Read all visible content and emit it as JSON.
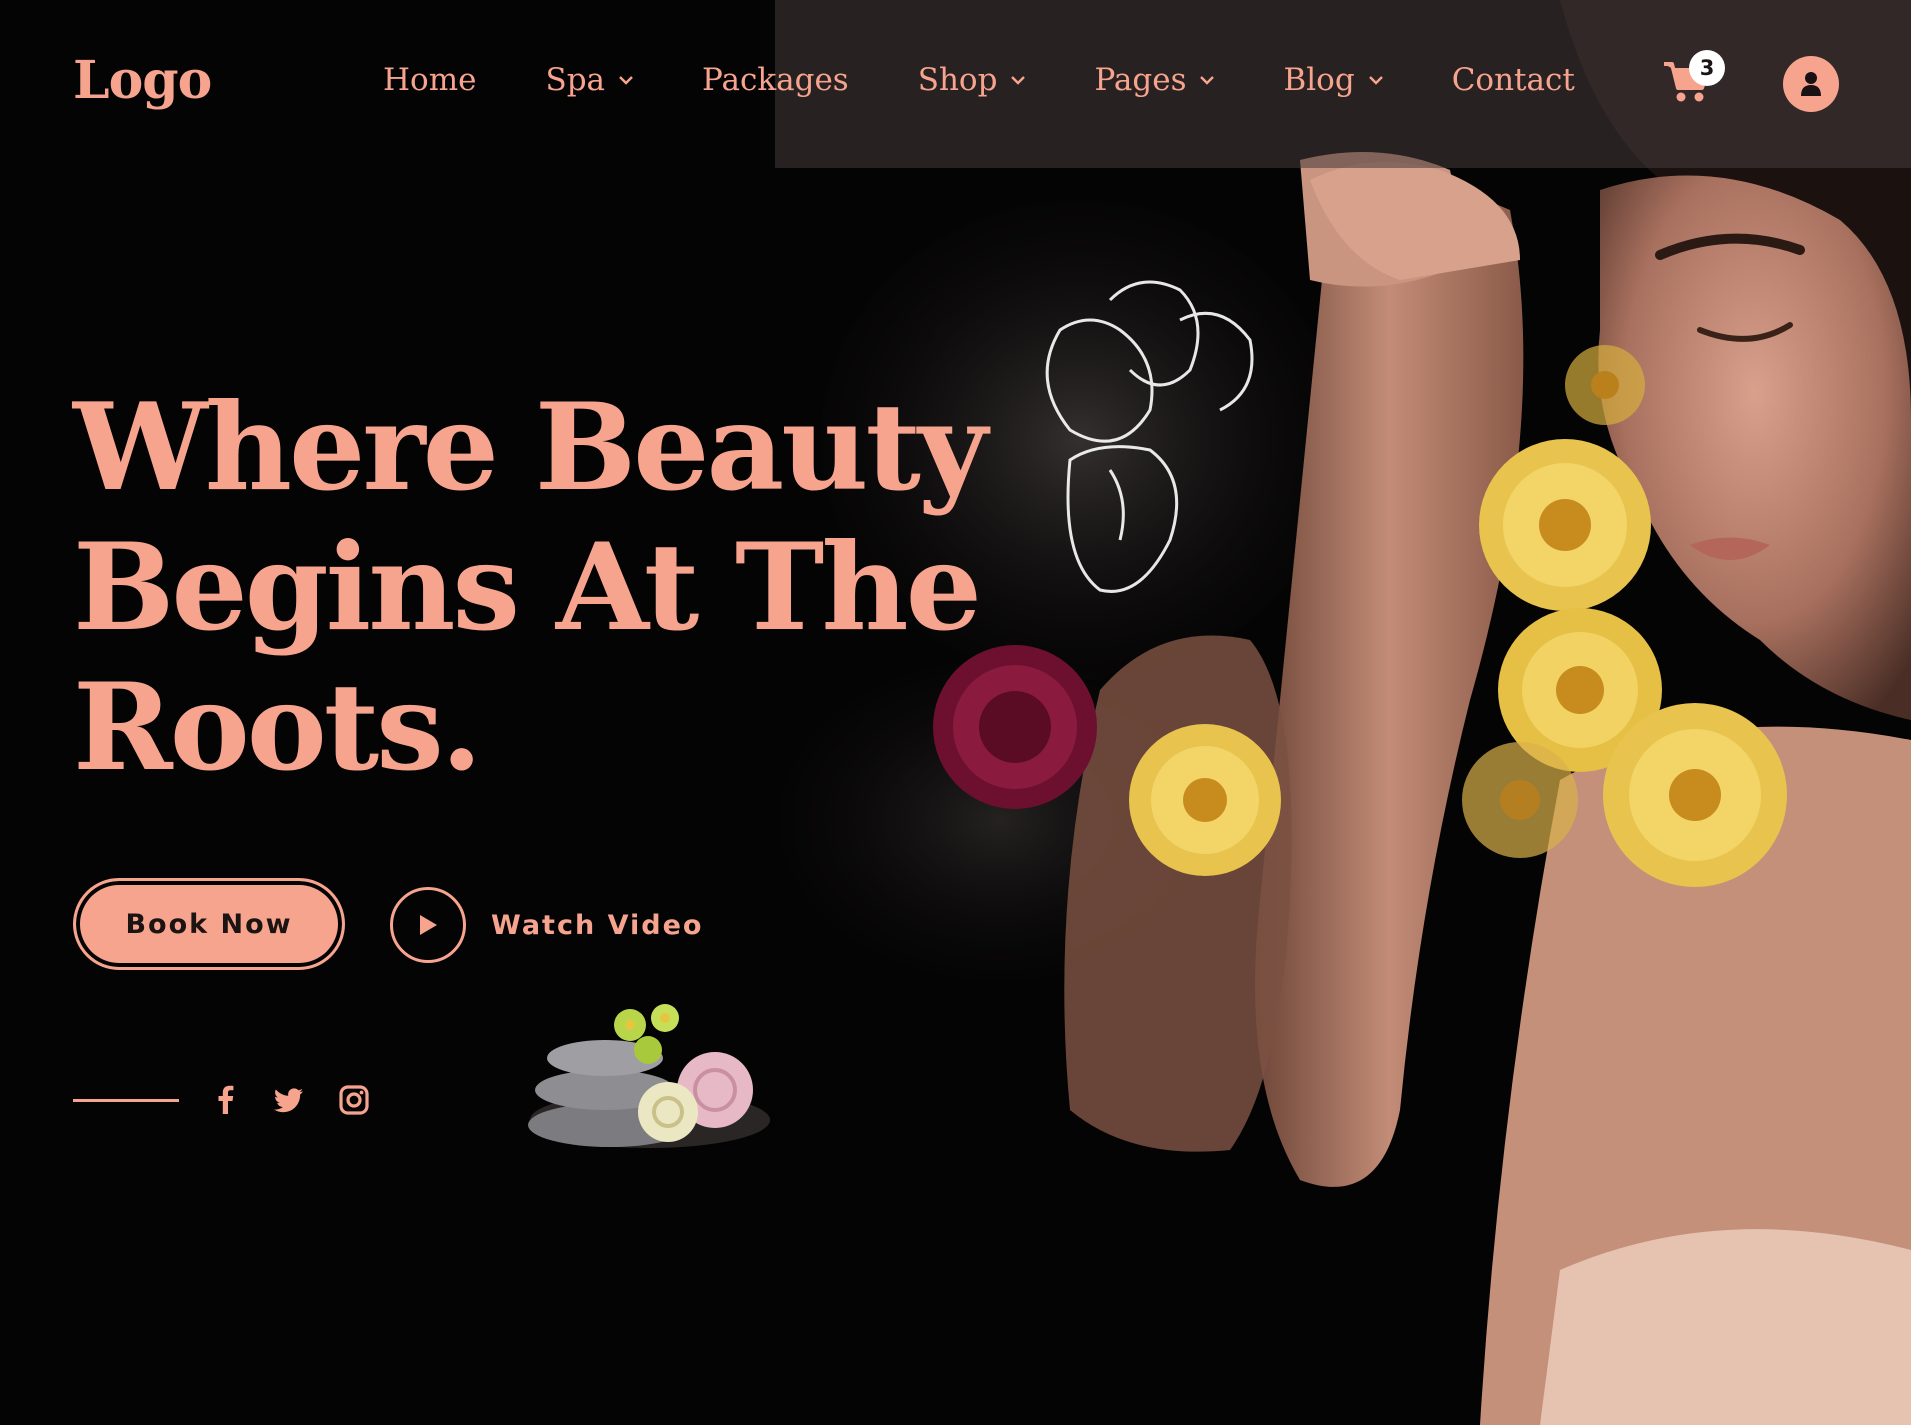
{
  "header": {
    "logo": "Logo",
    "nav": [
      {
        "label": "Home",
        "dropdown": false
      },
      {
        "label": "Spa",
        "dropdown": true
      },
      {
        "label": "Packages",
        "dropdown": false
      },
      {
        "label": "Shop",
        "dropdown": true
      },
      {
        "label": "Pages",
        "dropdown": true
      },
      {
        "label": "Blog",
        "dropdown": true
      },
      {
        "label": "Contact",
        "dropdown": false
      }
    ],
    "cart": {
      "icon": "shopping-cart-icon",
      "count": "3"
    },
    "user": {
      "icon": "user-icon"
    }
  },
  "hero": {
    "headline": [
      "Where Beauty",
      "Begins At The",
      "Roots."
    ],
    "book_button": "Book Now",
    "watch_button": "Watch Video",
    "play_icon": "play-icon"
  },
  "social": [
    {
      "name": "facebook",
      "icon": "facebook-icon"
    },
    {
      "name": "twitter",
      "icon": "twitter-icon"
    },
    {
      "name": "instagram",
      "icon": "instagram-icon"
    }
  ],
  "theme": {
    "accent": "#f7a48f",
    "background": "#050404",
    "header_band": "#463a3a"
  }
}
